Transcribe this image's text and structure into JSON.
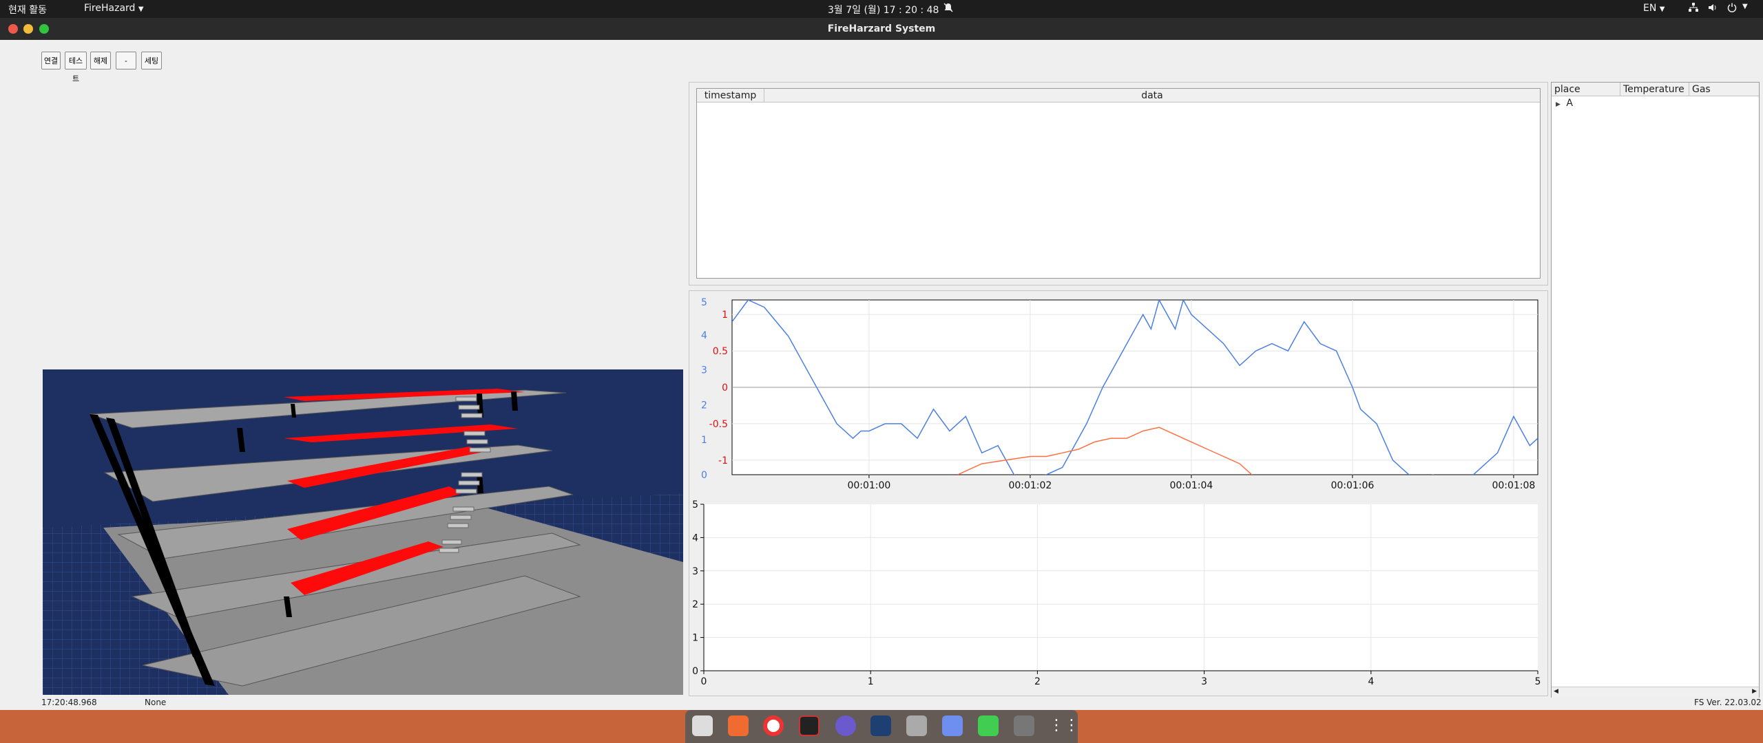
{
  "topbar": {
    "activities": "현재 활동",
    "app_menu": "FireHazard",
    "clock": "3월 7일 (월)  17 : 20 : 48",
    "lang": "EN"
  },
  "window": {
    "title": "FireHarzard System"
  },
  "toolbar": {
    "connect": "연결",
    "test": "테스트",
    "release": "해제",
    "dash": "-",
    "setting": "세팅"
  },
  "log_table": {
    "col_timestamp": "timestamp",
    "col_data": "data"
  },
  "sensor_tree": {
    "col_place": "place",
    "col_temperature": "Temperature",
    "col_gas": "Gas",
    "items": [
      "A"
    ]
  },
  "status_bar": {
    "time": "17:20:48.968",
    "state": "None",
    "version": "FS Ver. 22.03.02"
  },
  "colors": {
    "series_blue": "#4a7fe6",
    "series_orange": "#ff7040",
    "axis_red": "#e01010"
  },
  "chart_data": [
    {
      "type": "line",
      "title": "",
      "xlabel": "",
      "ylabel": "",
      "x_ticks": [
        "00:01:00",
        "00:01:02",
        "00:01:04",
        "00:01:06",
        "00:01:08"
      ],
      "y_left_ticks": [
        "0",
        "1",
        "2",
        "3",
        "4",
        "5"
      ],
      "y_right_ticks": [
        "-1",
        "-0.5",
        "0",
        "0.5",
        "1"
      ],
      "xlim": [
        58.3,
        68.3
      ],
      "ylim_left": [
        0,
        5
      ],
      "ylim_right": [
        -1.2,
        1.2
      ],
      "grid": true,
      "series": [
        {
          "color": "#4a7fe6",
          "axis": "right",
          "x": [
            58.3,
            58.5,
            58.7,
            59.0,
            59.2,
            59.4,
            59.6,
            59.8,
            59.9,
            60.0,
            60.2,
            60.4,
            60.6,
            60.8,
            61.0,
            61.2,
            61.4,
            61.6,
            61.8,
            62.0,
            62.4,
            62.7,
            62.9,
            63.1,
            63.2,
            63.4,
            63.5,
            63.6,
            63.8,
            63.9,
            64.0,
            64.2,
            64.4,
            64.6,
            64.8,
            65.0,
            65.2,
            65.4,
            65.6,
            65.8,
            66.0,
            66.1,
            66.3,
            66.5,
            66.8,
            67.0,
            67.3,
            67.6,
            67.8,
            68.0,
            68.2,
            68.3
          ],
          "y": [
            0.9,
            1.2,
            1.1,
            0.7,
            0.3,
            -0.1,
            -0.5,
            -0.7,
            -0.6,
            -0.6,
            -0.5,
            -0.5,
            -0.7,
            -0.3,
            -0.6,
            -0.4,
            -0.9,
            -0.8,
            -1.2,
            -1.3,
            -1.1,
            -0.5,
            0.0,
            0.4,
            0.6,
            1.0,
            0.8,
            1.2,
            0.8,
            1.2,
            1.0,
            0.8,
            0.6,
            0.3,
            0.5,
            0.6,
            0.5,
            0.9,
            0.6,
            0.5,
            0.0,
            -0.3,
            -0.5,
            -1.0,
            -1.3,
            -1.2,
            -1.4,
            -1.1,
            -0.9,
            -0.4,
            -0.8,
            -0.7
          ]
        },
        {
          "color": "#ff7040",
          "axis": "right",
          "x": [
            61.1,
            61.4,
            61.7,
            62.0,
            62.2,
            62.4,
            62.6,
            62.8,
            63.0,
            63.2,
            63.4,
            63.6,
            63.8,
            64.0,
            64.2,
            64.4,
            64.6,
            64.8
          ],
          "y": [
            -1.2,
            -1.05,
            -1.0,
            -0.95,
            -0.95,
            -0.9,
            -0.85,
            -0.75,
            -0.7,
            -0.7,
            -0.6,
            -0.55,
            -0.65,
            -0.75,
            -0.85,
            -0.95,
            -1.05,
            -1.25
          ]
        }
      ]
    },
    {
      "type": "line",
      "title": "",
      "x_ticks": [
        "0",
        "1",
        "2",
        "3",
        "4",
        "5"
      ],
      "y_ticks": [
        "0",
        "1",
        "2",
        "3",
        "4",
        "5"
      ],
      "xlim": [
        0,
        5
      ],
      "ylim": [
        0,
        5
      ],
      "grid": true,
      "series": []
    }
  ]
}
